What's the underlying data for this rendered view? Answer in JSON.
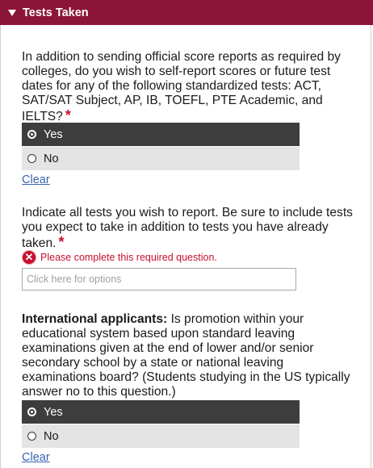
{
  "section": {
    "title": "Tests Taken"
  },
  "q1": {
    "text": "In addition to sending official score reports as required by colleges, do you wish to self-report scores or future test dates for any of the following standardized tests: ACT, SAT/SAT Subject, AP, IB, TOEFL, PTE Academic, and IELTS?",
    "required_mark": "*",
    "options": [
      {
        "label": "Yes",
        "selected": true
      },
      {
        "label": "No",
        "selected": false
      }
    ],
    "clear_label": "Clear"
  },
  "q2": {
    "text": "Indicate all tests you wish to report. Be sure to include tests you expect to take in addition to tests you have already taken.",
    "required_mark": "*",
    "error_text": "Please complete this required question.",
    "placeholder": "Click here for options"
  },
  "q3": {
    "lead": "International applicants:",
    "text": " Is promotion within your educational system based upon standard leaving examinations given at the end of lower and/or senior secondary school by a state or national leaving examinations board? (Students studying in the US typically answer no to this question.)",
    "options": [
      {
        "label": "Yes",
        "selected": true
      },
      {
        "label": "No",
        "selected": false
      }
    ],
    "clear_label": "Clear"
  },
  "colors": {
    "header_bg": "#8b1538",
    "selected_bg": "#3d3d3d",
    "unselected_bg": "#e4e4e4",
    "error": "#c8102e",
    "link": "#3a62b0"
  }
}
